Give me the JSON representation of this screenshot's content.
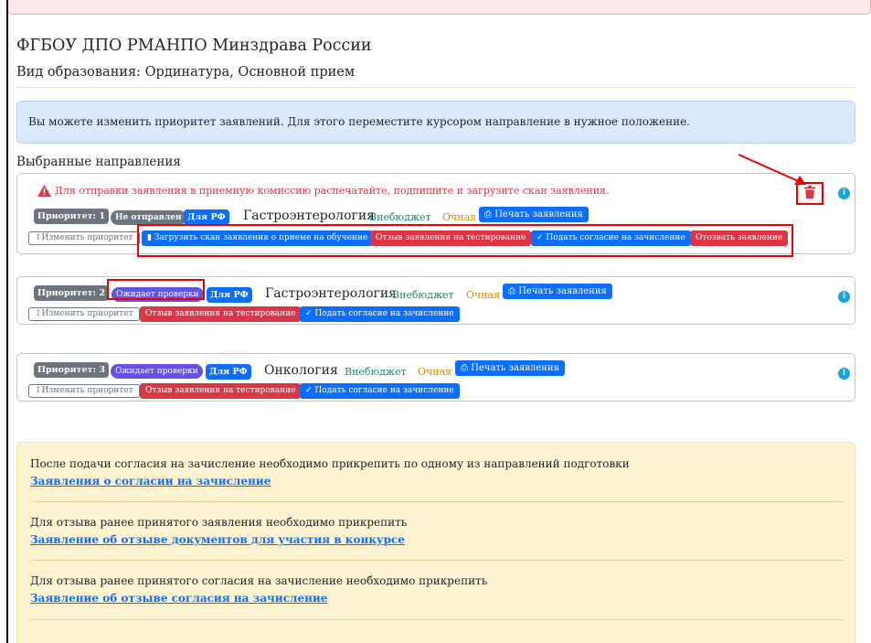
{
  "header": {
    "org_title": "ФГБОУ ДПО РМАНПО Минздрава России",
    "education_type": "Вид образования: Ординатура, Основной прием"
  },
  "info_alert": {
    "text": "Вы можете изменить приоритет заявлений. Для этого переместите курсором направление в нужное положение."
  },
  "selected_title": "Выбранные направления",
  "applications": [
    {
      "priority": "Приоритет: 1",
      "status": "Не отправлен",
      "citizenship": "Для РФ",
      "speciality": "Гастроэнтерология",
      "financing": "Внебюджет",
      "form": "Очная",
      "print_label": "Печать заявления",
      "warning": "Для отправки заявления в приемную комиссию распечатайте, подпишите и загрузите скан заявления.",
      "change_priority": "Изменить приоритет",
      "upload_scan": "Загрузить скан заявления о приеме на обучение",
      "withdraw_test": "Отзыв заявления на тестирование",
      "consent": "Подать согласие на зачисление",
      "withdraw": "Отозвать заявление"
    },
    {
      "priority": "Приоритет: 2",
      "status": "Ожидает проверки",
      "citizenship": "Для РФ",
      "speciality": "Гастроэнтерология",
      "financing": "Внебюджет",
      "form": "Очная",
      "print_label": "Печать заявления",
      "change_priority": "Изменить приоритет",
      "withdraw_test": "Отзыв заявления на тестирование",
      "consent": "Подать согласие на зачисление"
    },
    {
      "priority": "Приоритет: 3",
      "status": "Ожидает проверки",
      "citizenship": "Для РФ",
      "speciality": "Онкология",
      "financing": "Внебюджет",
      "form": "Очная",
      "print_label": "Печать заявления",
      "change_priority": "Изменить приоритет",
      "withdraw_test": "Отзыв заявления на тестирование",
      "consent": "Подать согласие на зачисление"
    }
  ],
  "notice": {
    "consent_text": "После подачи согласия на зачисление необходимо прикрепить по одному из направлений подготовки",
    "consent_link": "Заявления о согласии на зачисление",
    "withdraw_app_text": "Для отзыва ранее принятого заявления необходимо прикрепить",
    "withdraw_app_link": "Заявление об отзыве документов для участия в конкурсе",
    "withdraw_consent_text": "Для отзыва ранее принятого согласия на зачисление необходимо прикрепить",
    "withdraw_consent_link": "Заявление об отзыве согласия на зачисление"
  },
  "colors": {
    "primary": "#0d6efd",
    "danger": "#dc3545",
    "secondary": "#6c757d",
    "success_text": "#20876b",
    "warning_text": "#e08a00",
    "annotation_red": "#ee0000"
  }
}
